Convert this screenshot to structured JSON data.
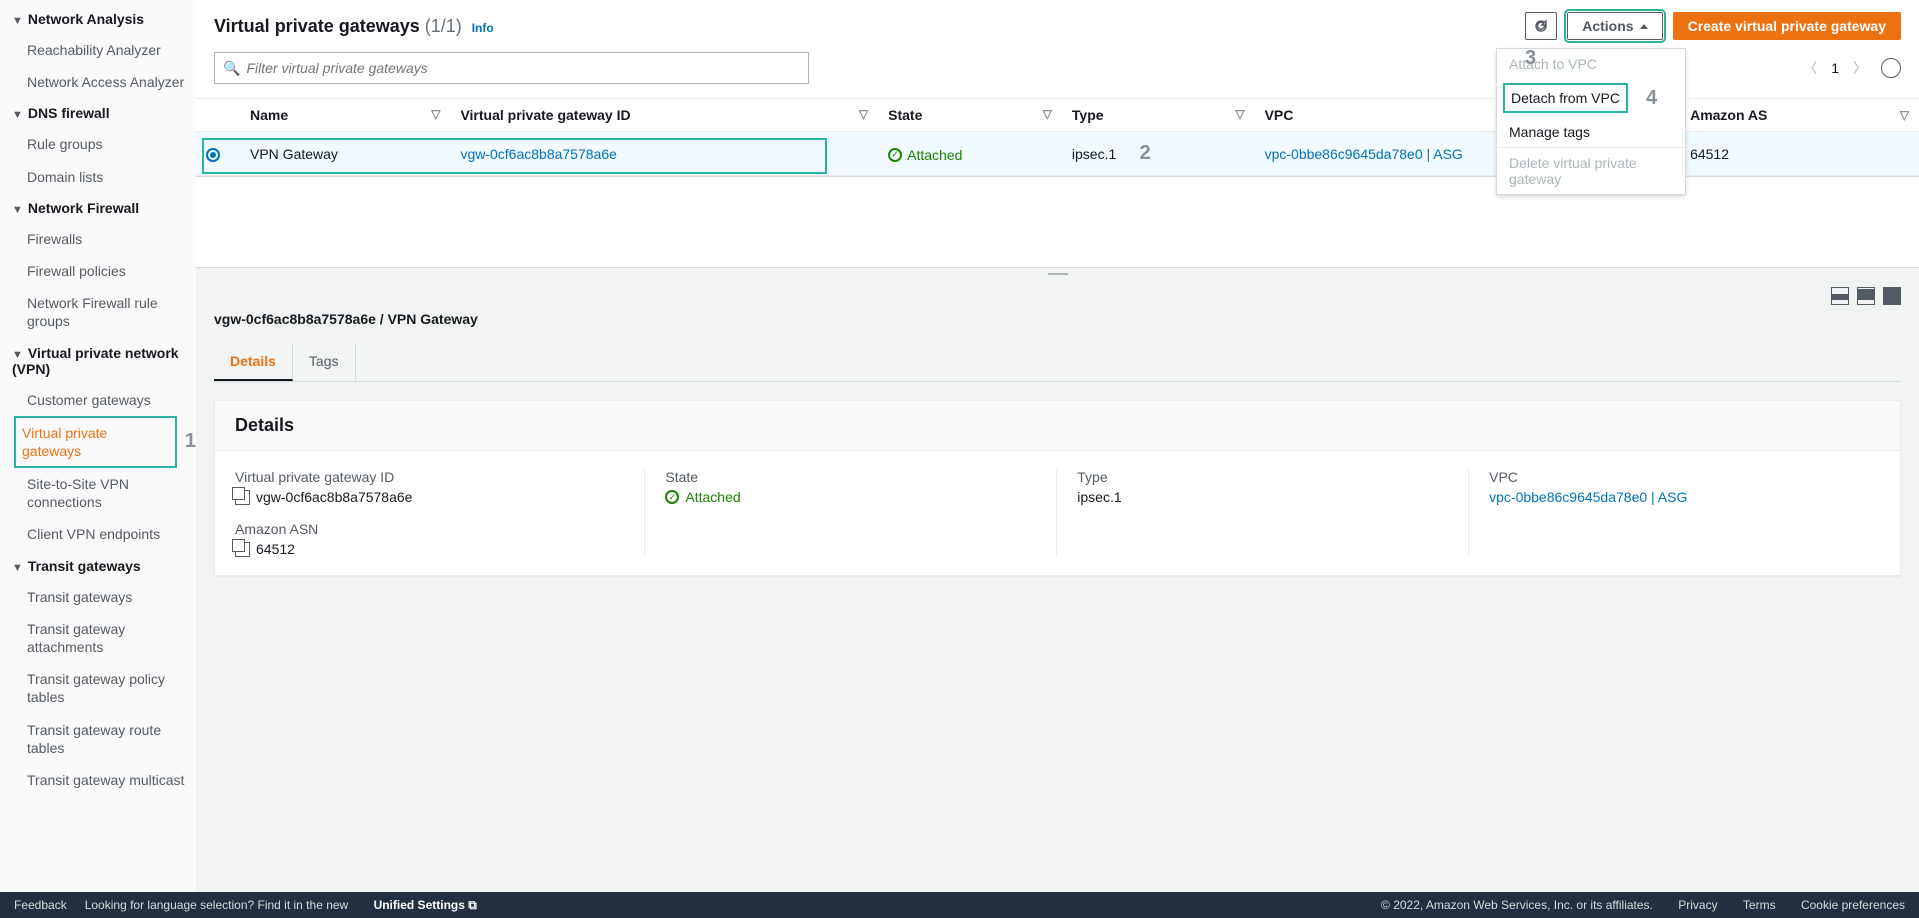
{
  "sidebar": {
    "groups": [
      {
        "title": "Network Analysis",
        "items": [
          "Reachability Analyzer",
          "Network Access Analyzer"
        ]
      },
      {
        "title": "DNS firewall",
        "items": [
          "Rule groups",
          "Domain lists"
        ]
      },
      {
        "title": "Network Firewall",
        "items": [
          "Firewalls",
          "Firewall policies",
          "Network Firewall rule groups"
        ]
      },
      {
        "title": "Virtual private network (VPN)",
        "items": [
          "Customer gateways",
          "Virtual private gateways",
          "Site-to-Site VPN connections",
          "Client VPN endpoints"
        ],
        "activeIndex": 1
      },
      {
        "title": "Transit gateways",
        "items": [
          "Transit gateways",
          "Transit gateway attachments",
          "Transit gateway policy tables",
          "Transit gateway route tables",
          "Transit gateway multicast"
        ]
      }
    ]
  },
  "header": {
    "title": "Virtual private gateways",
    "count": "(1/1)",
    "info": "Info",
    "actions": "Actions",
    "create": "Create virtual private gateway",
    "filter_placeholder": "Filter virtual private gateways",
    "page": "1"
  },
  "actions_menu": {
    "attach": "Attach to VPC",
    "detach": "Detach from VPC",
    "tags": "Manage tags",
    "delete": "Delete virtual private gateway"
  },
  "badges": {
    "b1": "1",
    "b2": "2",
    "b3": "3",
    "b4": "4"
  },
  "table": {
    "cols": [
      "Name",
      "Virtual private gateway ID",
      "State",
      "Type",
      "VPC",
      "Amazon AS"
    ],
    "row": {
      "name": "VPN Gateway",
      "id": "vgw-0cf6ac8b8a7578a6e",
      "state": "Attached",
      "type": "ipsec.1",
      "vpc": "vpc-0bbe86c9645da78e0 | ASG",
      "asn": "64512"
    }
  },
  "detail": {
    "breadcrumb": "vgw-0cf6ac8b8a7578a6e / VPN Gateway",
    "tab_details": "Details",
    "tab_tags": "Tags",
    "card_title": "Details",
    "f_id_label": "Virtual private gateway ID",
    "f_id_val": "vgw-0cf6ac8b8a7578a6e",
    "f_asn_label": "Amazon ASN",
    "f_asn_val": "64512",
    "f_state_label": "State",
    "f_state_val": "Attached",
    "f_type_label": "Type",
    "f_type_val": "ipsec.1",
    "f_vpc_label": "VPC",
    "f_vpc_val": "vpc-0bbe86c9645da78e0 | ASG"
  },
  "footer": {
    "feedback": "Feedback",
    "lang": "Looking for language selection? Find it in the new",
    "unified": "Unified Settings",
    "copyright": "© 2022, Amazon Web Services, Inc. or its affiliates.",
    "privacy": "Privacy",
    "terms": "Terms",
    "cookies": "Cookie preferences"
  }
}
